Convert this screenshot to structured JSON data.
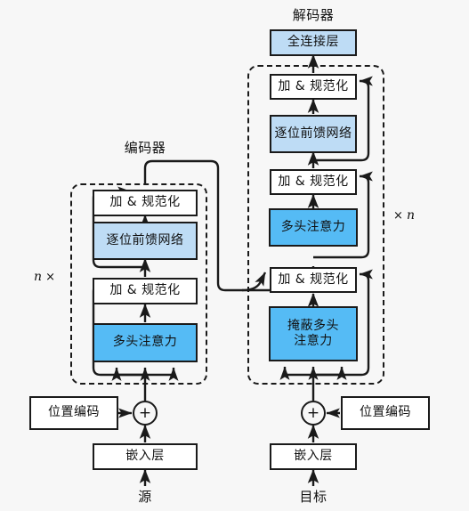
{
  "diagram": {
    "title_encoder": "编码器",
    "title_decoder": "解码器",
    "background_color": "#f7f7f7",
    "stroke_color": "#1a1a1a",
    "fill_light": "#bedcf5",
    "fill_dark": "#55bbf5",
    "fill_plain": "#ffffff"
  },
  "encoder": {
    "heading": "编码器",
    "repeat": "n ×",
    "blocks": {
      "addnorm_top": "加 & 规范化",
      "feedforward": "逐位前馈网络",
      "addnorm_bottom": "加 & 规范化",
      "attention": "多头注意力"
    }
  },
  "decoder": {
    "heading": "解码器",
    "repeat": "× n",
    "blocks": {
      "dense": "全连接层",
      "addnorm_top": "加 & 规范化",
      "feedforward": "逐位前馈网络",
      "addnorm_mid": "加 & 规范化",
      "attention": "多头注意力",
      "addnorm_bottom": "加 & 规范化",
      "masked_attention": "掩蔽多头\n注意力"
    }
  },
  "inputs": {
    "source_positional": "位置编码",
    "source_embedding": "嵌入层",
    "source_label": "源",
    "target_positional": "位置编码",
    "target_embedding": "嵌入层",
    "target_label": "目标",
    "adder_symbol": "+"
  }
}
